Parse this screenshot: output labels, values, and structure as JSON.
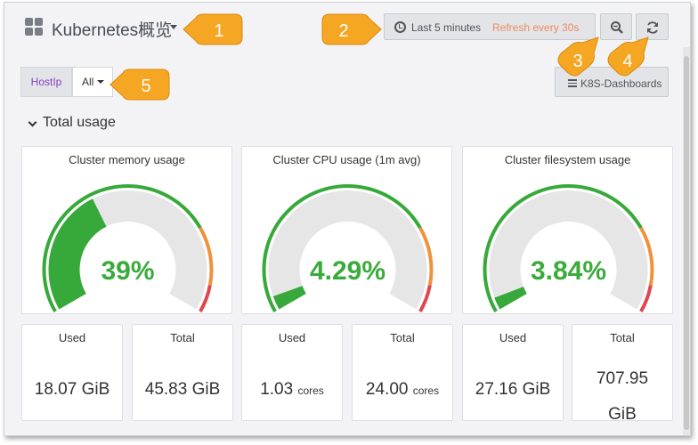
{
  "header": {
    "title": "Kubernetes概览",
    "time_range": "Last 5 minutes",
    "refresh": "Refresh every 30s",
    "zoom_icon": "zoom-out-icon",
    "reload_icon": "refresh-icon"
  },
  "variables": {
    "label": "HostIp",
    "value": "All",
    "links_label": "K8S-Dashboards"
  },
  "row": {
    "title": "Total usage"
  },
  "gauges": [
    {
      "title": "Cluster memory usage",
      "value": "39%",
      "percent": 39
    },
    {
      "title": "Cluster CPU usage (1m avg)",
      "value": "4.29%",
      "percent": 4.29
    },
    {
      "title": "Cluster filesystem usage",
      "value": "3.84%",
      "percent": 3.84
    }
  ],
  "stats": [
    {
      "title": "Used",
      "value": "18.07 GiB",
      "unit": ""
    },
    {
      "title": "Total",
      "value": "45.83 GiB",
      "unit": ""
    },
    {
      "title": "Used",
      "value": "1.03",
      "unit": "cores"
    },
    {
      "title": "Total",
      "value": "24.00",
      "unit": "cores"
    },
    {
      "title": "Used",
      "value": "27.16 GiB",
      "unit": ""
    },
    {
      "title": "Total",
      "value": "707.95",
      "unit": "GiB"
    }
  ],
  "callouts": [
    "1",
    "2",
    "3",
    "4",
    "5"
  ],
  "colors": {
    "gauge_green": "#37a93a",
    "gauge_orange": "#ef923d",
    "gauge_red": "#e0474f",
    "gauge_track": "#e6e6e6",
    "value_green": "#3aab3b",
    "callout": "#f5a623",
    "refresh_text": "#f08a5b",
    "variable_label": "#8a3fbf"
  }
}
